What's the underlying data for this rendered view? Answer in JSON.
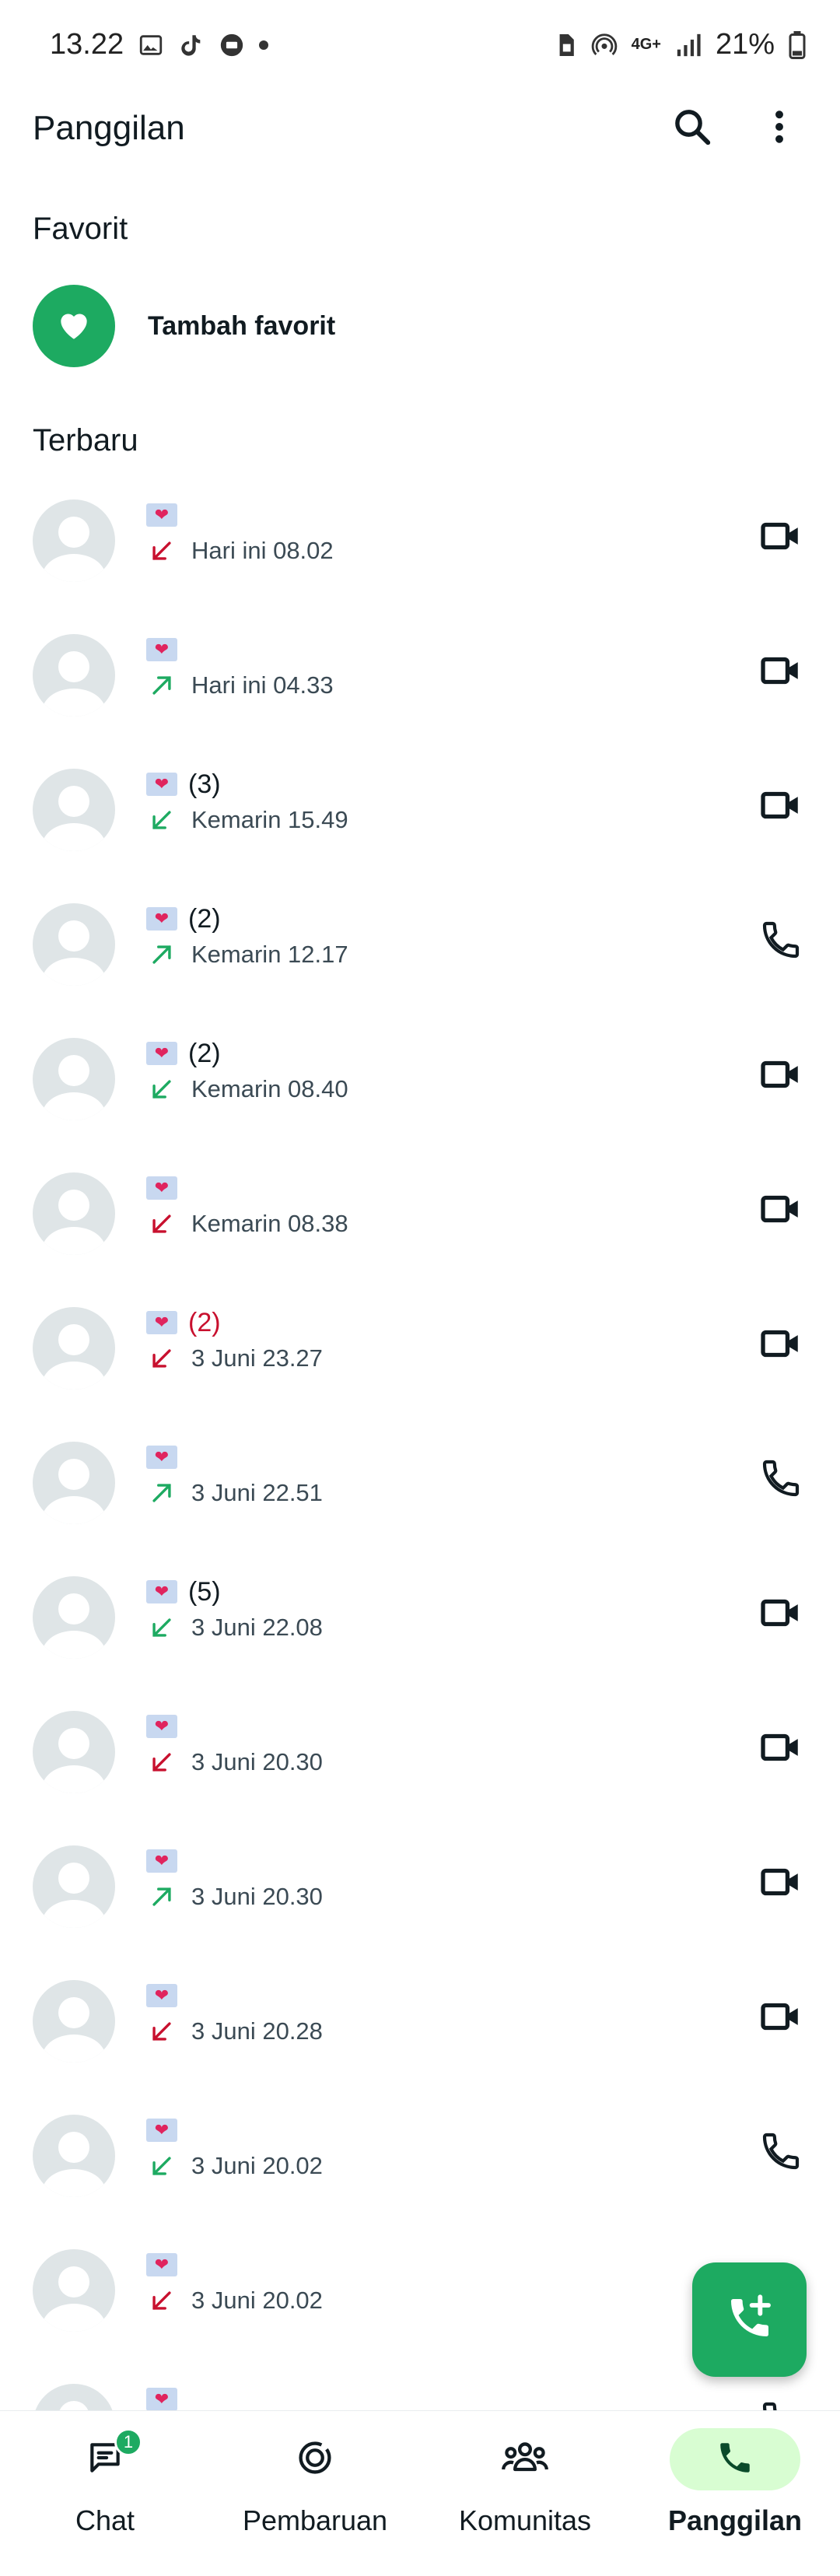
{
  "status_bar": {
    "time": "13.22",
    "network": "4G+",
    "battery": "21%"
  },
  "app_bar": {
    "title": "Panggilan"
  },
  "favorites": {
    "heading": "Favorit",
    "add_label": "Tambah favorit"
  },
  "recent": {
    "heading": "Terbaru"
  },
  "calls": [
    {
      "count": "",
      "direction": "incoming",
      "status": "missed",
      "time": "Hari ini 08.02",
      "type": "video"
    },
    {
      "count": "",
      "direction": "outgoing",
      "status": "answered",
      "time": "Hari ini 04.33",
      "type": "video"
    },
    {
      "count": "(3)",
      "direction": "incoming",
      "status": "answered",
      "time": "Kemarin 15.49",
      "type": "video"
    },
    {
      "count": "(2)",
      "direction": "outgoing",
      "status": "answered",
      "time": "Kemarin 12.17",
      "type": "voice"
    },
    {
      "count": "(2)",
      "direction": "incoming",
      "status": "answered",
      "time": "Kemarin 08.40",
      "type": "video"
    },
    {
      "count": "",
      "direction": "incoming",
      "status": "missed",
      "time": "Kemarin 08.38",
      "type": "video"
    },
    {
      "count": "(2)",
      "direction": "incoming",
      "status": "missed",
      "time": "3 Juni 23.27",
      "type": "video"
    },
    {
      "count": "",
      "direction": "outgoing",
      "status": "answered",
      "time": "3 Juni 22.51",
      "type": "voice"
    },
    {
      "count": "(5)",
      "direction": "incoming",
      "status": "answered",
      "time": "3 Juni 22.08",
      "type": "video"
    },
    {
      "count": "",
      "direction": "incoming",
      "status": "missed",
      "time": "3 Juni 20.30",
      "type": "video"
    },
    {
      "count": "",
      "direction": "outgoing",
      "status": "answered",
      "time": "3 Juni 20.30",
      "type": "video"
    },
    {
      "count": "",
      "direction": "incoming",
      "status": "missed",
      "time": "3 Juni 20.28",
      "type": "video"
    },
    {
      "count": "",
      "direction": "incoming",
      "status": "answered",
      "time": "3 Juni 20.02",
      "type": "voice"
    },
    {
      "count": "",
      "direction": "incoming",
      "status": "missed",
      "time": "3 Juni 20.02",
      "type": "voice"
    },
    {
      "count": "",
      "direction": "incoming",
      "status": "answered",
      "time": "",
      "type": "voice"
    }
  ],
  "bottom_nav": [
    {
      "label": "Chat",
      "icon": "chat-icon",
      "badge": "1",
      "active": false
    },
    {
      "label": "Pembaruan",
      "icon": "updates-icon",
      "badge": "",
      "active": false
    },
    {
      "label": "Komunitas",
      "icon": "communities-icon",
      "badge": "",
      "active": false
    },
    {
      "label": "Panggilan",
      "icon": "calls-icon",
      "badge": "",
      "active": true
    }
  ],
  "colors": {
    "accent": "#1daa61",
    "missed": "#c8102e",
    "answered": "#1daa61",
    "active_nav_bg": "#d8fdd2",
    "avatar_bg": "#dfe5e7"
  }
}
